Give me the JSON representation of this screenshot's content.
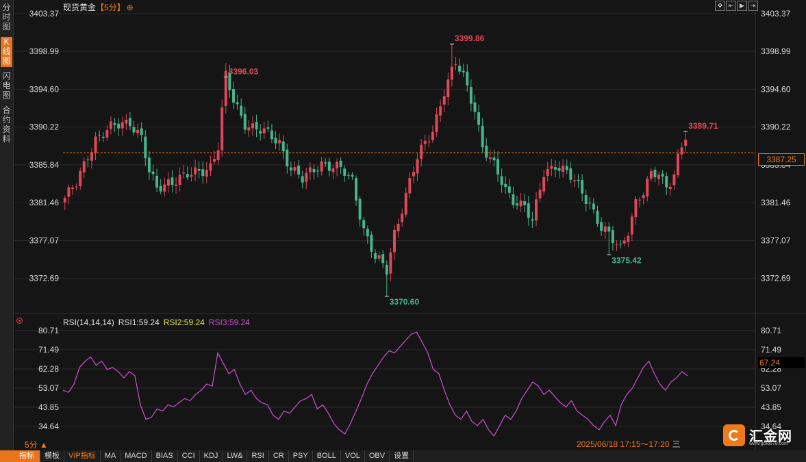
{
  "sidebar": {
    "tabs": [
      {
        "label": "分时图",
        "active": false
      },
      {
        "label": "K线图",
        "active": true
      },
      {
        "label": "闪电图",
        "active": false
      },
      {
        "label": "合约资料",
        "active": false
      }
    ]
  },
  "header": {
    "instrument": "现货黄金",
    "period": "【5分】",
    "add_icon": "⊕",
    "toolbar_icons": [
      "expand-icon",
      "bar-start-icon",
      "play-icon",
      "bar-end-icon"
    ]
  },
  "price_axis": {
    "ticks": [
      "3403.37",
      "3398.99",
      "3394.60",
      "3390.22",
      "3385.84",
      "3381.46",
      "3377.07",
      "3372.69"
    ],
    "current_price": "3387.25"
  },
  "price_annotations": [
    {
      "label": "3396.03",
      "type": "high"
    },
    {
      "label": "3399.86",
      "type": "high"
    },
    {
      "label": "3370.60",
      "type": "low"
    },
    {
      "label": "3375.42",
      "type": "low"
    },
    {
      "label": "3389.71",
      "type": "high"
    }
  ],
  "rsi": {
    "title": "RSI(14,14,14)",
    "rsi1": "RSI1:59.24",
    "rsi2": "RSI2:59.24",
    "rsi3": "RSI3:59.24",
    "ticks": [
      "80.71",
      "71.49",
      "62.28",
      "53.07",
      "43.85",
      "34.64"
    ],
    "current": "67.24"
  },
  "footer": {
    "period_label": "5分 ▲",
    "time_range": "2025/06/18 17:15～17:20",
    "time_range_suffix": "三",
    "tabs": [
      {
        "label": "指标",
        "active": true
      },
      {
        "label": "模板"
      },
      {
        "label": "VIP指标",
        "vip": true
      },
      {
        "label": "MA"
      },
      {
        "label": "MACD"
      },
      {
        "label": "BIAS"
      },
      {
        "label": "CCI"
      },
      {
        "label": "KDJ"
      },
      {
        "label": "LW&"
      },
      {
        "label": "RSI"
      },
      {
        "label": "CR"
      },
      {
        "label": "PSY"
      },
      {
        "label": "BOLL"
      },
      {
        "label": "VOL"
      },
      {
        "label": "OBV"
      },
      {
        "label": "设置"
      }
    ]
  },
  "logo": {
    "name": "汇金网",
    "url": "www.gold678.com"
  },
  "colors": {
    "up": "#e04757",
    "down": "#46b68a",
    "accent": "#f07a18",
    "rsi1": "#ffffff",
    "rsi2": "#e8e04a",
    "rsi3": "#d34fd3",
    "rsi_line": "#d34fd3"
  },
  "chart_data": [
    {
      "type": "candlestick",
      "title": "现货黄金【5分】",
      "ylim": [
        3370.6,
        3403.37
      ],
      "y_ticks": [
        3403.37,
        3398.99,
        3394.6,
        3390.22,
        3385.84,
        3381.46,
        3377.07,
        3372.69
      ],
      "reference_line": 3387.25,
      "close_path": [
        [
          0,
          3382.0
        ],
        [
          3,
          3383.5
        ],
        [
          6,
          3387.0
        ],
        [
          8,
          3389.0
        ],
        [
          12,
          3390.0
        ],
        [
          17,
          3391.0
        ],
        [
          20,
          3389.0
        ],
        [
          22,
          3384.8
        ],
        [
          24,
          3383.0
        ],
        [
          27,
          3384.0
        ],
        [
          33,
          3384.6
        ],
        [
          38,
          3385.8
        ],
        [
          40,
          3388.0
        ],
        [
          42,
          3396.0
        ],
        [
          44,
          3393.2
        ],
        [
          47,
          3390.8
        ],
        [
          52,
          3389.5
        ],
        [
          56,
          3388.5
        ],
        [
          59,
          3385.5
        ],
        [
          62,
          3384.0
        ],
        [
          67,
          3386.2
        ],
        [
          72,
          3385.2
        ],
        [
          75,
          3384.0
        ],
        [
          78,
          3378.5
        ],
        [
          81,
          3375.0
        ],
        [
          84,
          3373.5
        ],
        [
          86,
          3378.0
        ],
        [
          89,
          3382.5
        ],
        [
          92,
          3386.5
        ],
        [
          96,
          3390.0
        ],
        [
          99,
          3394.5
        ],
        [
          102,
          3397.5
        ],
        [
          104,
          3396.0
        ],
        [
          107,
          3392.5
        ],
        [
          109,
          3388.0
        ],
        [
          112,
          3385.5
        ],
        [
          115,
          3383.0
        ],
        [
          117,
          3382.0
        ],
        [
          120,
          3381.0
        ],
        [
          122,
          3379.0
        ],
        [
          125,
          3385.0
        ],
        [
          128,
          3386.0
        ],
        [
          131,
          3384.8
        ],
        [
          134,
          3383.3
        ],
        [
          137,
          3381.5
        ],
        [
          140,
          3378.5
        ],
        [
          143,
          3377.0
        ],
        [
          145,
          3376.2
        ],
        [
          147,
          3378.5
        ],
        [
          149,
          3381.5
        ],
        [
          151,
          3382.5
        ],
        [
          153,
          3384.5
        ],
        [
          155,
          3385.0
        ],
        [
          157,
          3383.5
        ],
        [
          159,
          3384.8
        ],
        [
          160,
          3386.5
        ],
        [
          161,
          3387.8
        ],
        [
          162,
          3388.9
        ]
      ],
      "annotations": [
        {
          "label": "3396.03",
          "x": 42,
          "y": 3396.03
        },
        {
          "label": "3399.86",
          "x": 101,
          "y": 3399.86
        },
        {
          "label": "3370.60",
          "x": 84,
          "y": 3370.6
        },
        {
          "label": "3375.42",
          "x": 142,
          "y": 3375.42
        },
        {
          "label": "3389.71",
          "x": 162,
          "y": 3389.71
        }
      ]
    },
    {
      "type": "line",
      "title": "RSI(14,14,14)",
      "ylim": [
        30,
        80.71
      ],
      "y_ticks": [
        80.71,
        71.49,
        62.28,
        53.07,
        43.85,
        34.64
      ],
      "series": [
        {
          "name": "RSI1",
          "values": [
            52,
            51,
            55,
            63,
            66,
            68,
            64,
            66,
            62,
            63,
            61,
            58,
            61,
            59,
            45,
            38,
            39,
            43,
            42,
            45,
            44,
            46,
            48,
            47,
            50,
            52,
            55,
            54,
            70,
            65,
            60,
            62,
            55,
            50,
            52,
            48,
            46,
            45,
            40,
            38,
            42,
            41,
            44,
            47,
            48,
            50,
            43,
            45,
            41,
            36,
            33,
            31,
            36,
            42,
            48,
            55,
            60,
            64,
            68,
            71,
            70,
            73,
            76,
            79,
            80,
            75,
            70,
            62,
            60,
            52,
            45,
            40,
            38,
            42,
            37,
            35,
            38,
            33,
            30,
            35,
            40,
            38,
            42,
            48,
            52,
            56,
            54,
            50,
            52,
            49,
            46,
            44,
            47,
            42,
            40,
            38,
            35,
            33,
            37,
            40,
            35,
            45,
            50,
            53,
            58,
            63,
            66,
            60,
            55,
            52,
            56,
            58,
            61,
            59
          ]
        }
      ]
    }
  ]
}
